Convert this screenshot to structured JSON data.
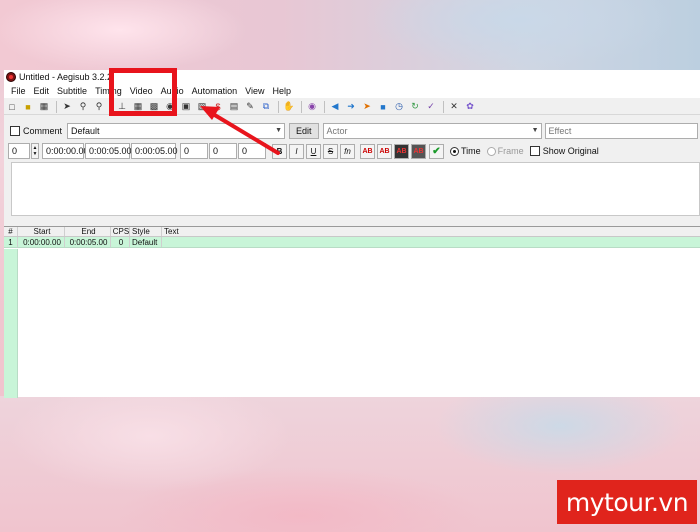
{
  "window": {
    "title": "Untitled - Aegisub 3.2.2"
  },
  "menu": [
    "File",
    "Edit",
    "Subtitle",
    "Timing",
    "Video",
    "Audio",
    "Automation",
    "View",
    "Help"
  ],
  "toolbar_icons": [
    "new-file-icon",
    "open-folder-icon",
    "save-icon",
    "jump-icon",
    "find-icon",
    "replace-icon",
    "cut-icon",
    "sort-icon",
    "video-icon",
    "globe-icon",
    "video-frame-icon",
    "keyframes-icon",
    "dollar-icon",
    "style-icon",
    "pen-icon",
    "copy-icon",
    "hand-icon",
    "spellcheck-icon",
    "shift-icon",
    "arrow-icon",
    "play-icon",
    "stop-icon",
    "clock-icon",
    "resample-icon",
    "check-icon",
    "tools-icon",
    "automation-icon"
  ],
  "editbox": {
    "comment_label": "Comment",
    "style": "Default",
    "edit_label": "Edit",
    "actor_placeholder": "Actor",
    "effect_placeholder": "Effect",
    "layer": "0",
    "start": "0:00:00.00",
    "end": "0:00:05.00",
    "duration": "0:00:05.00",
    "margin_l": "0",
    "margin_r": "0",
    "margin_v": "0",
    "format_buttons": [
      "B",
      "I",
      "U",
      "S",
      "fn"
    ],
    "color_buttons": [
      "AB",
      "AB",
      "AB",
      "AB"
    ],
    "time_label": "Time",
    "frame_label": "Frame",
    "show_original_label": "Show Original"
  },
  "grid": {
    "headers": [
      "#",
      "Start",
      "End",
      "CPS",
      "Style",
      "Text"
    ],
    "rows": [
      {
        "num": "1",
        "start": "0:00:00.00",
        "end": "0:00:05.00",
        "cps": "0",
        "style": "Default",
        "text": ""
      }
    ]
  },
  "watermark": "mytour.vn",
  "colors": {
    "highlight": "#e8141c",
    "selected_row": "#c8f5d8",
    "watermark_bg": "#e0241c"
  }
}
